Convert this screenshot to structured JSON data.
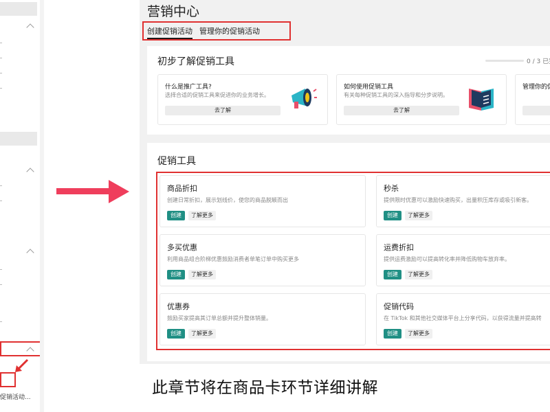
{
  "app": {
    "title": "营销中心",
    "tabs": [
      {
        "label": "创建促销活动",
        "active": true
      },
      {
        "label": "管理你的促销活动",
        "active": false
      }
    ]
  },
  "sidebar": {
    "partial_label": "促销活动..."
  },
  "intro_section": {
    "title": "初步了解促销工具",
    "progress_text": "0 / 3 已完",
    "progress_fraction": 0,
    "cards": [
      {
        "title": "什么是推广工具?",
        "desc": "选择合适的促销工具来促进你的业务增长。",
        "button": "去了解",
        "icon": "megaphone-icon"
      },
      {
        "title": "如何使用促销工具",
        "desc": "有关每种促销工具的深入指导和分步说明。",
        "button": "去了解",
        "icon": "book-icon"
      },
      {
        "title": "管理你的促",
        "desc": "",
        "button": "",
        "icon": ""
      }
    ]
  },
  "tools_section": {
    "title": "促销工具",
    "tools": [
      {
        "title": "商品折扣",
        "desc": "创建日常折扣，展示划线价，使您的商品脱颖而出",
        "create": "创建",
        "more": "了解更多"
      },
      {
        "title": "秒杀",
        "desc": "提供限时优惠可以激励快速购买，出量积压库存或吸引新客。",
        "create": "创建",
        "more": "了解更多"
      },
      {
        "title": "多买优惠",
        "desc": "利用商品组合阶梯优惠鼓励消费者单笔订单中购买更多",
        "create": "创建",
        "more": "了解更多"
      },
      {
        "title": "运费折扣",
        "desc": "提供运费激励可以提高转化率并降低购物车放弃率。",
        "create": "创建",
        "more": "了解更多"
      },
      {
        "title": "优惠券",
        "desc": "鼓励买家提高其订单总额并提升整体销量。",
        "create": "创建",
        "more": "了解更多"
      },
      {
        "title": "促销代码",
        "desc": "在 TikTok 和其他社交媒体平台上分享代码，以获得流量并提高转",
        "create": "创建",
        "more": "了解更多"
      }
    ]
  },
  "caption": "此章节将在商品卡环节详细讲解",
  "colors": {
    "accent_red": "#e03030",
    "arrow_pink": "#ef3e5c",
    "create_teal": "#1f8f84"
  }
}
